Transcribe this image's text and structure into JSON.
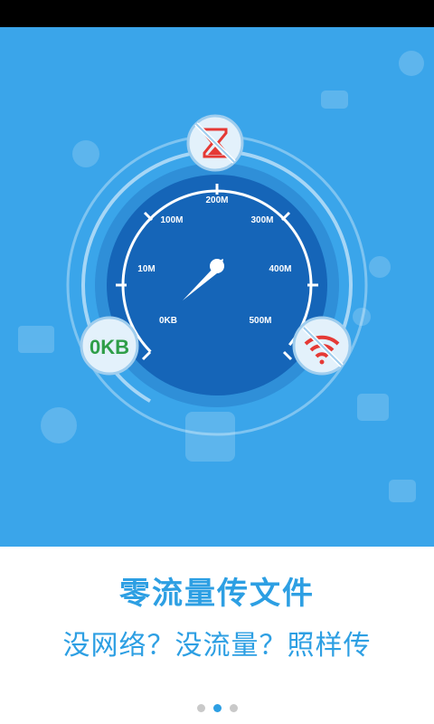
{
  "gauge": {
    "labels": [
      "0KB",
      "10M",
      "100M",
      "200M",
      "300M",
      "400M",
      "500M"
    ],
    "reading": "0KB"
  },
  "colors": {
    "hero_bg": "#3aa5ea",
    "gauge_dark": "#1565b8",
    "accent_text": "#2d9fe3",
    "reading_green": "#2e9e48",
    "warning_red": "#e53935"
  },
  "icons": {
    "top_badge": "hourglass-crossed-icon",
    "right_badge": "wifi-crossed-icon"
  },
  "title": "零流量传文件",
  "subtitle": "没网络？没流量？照样传",
  "pager": {
    "count": 3,
    "active": 1
  }
}
